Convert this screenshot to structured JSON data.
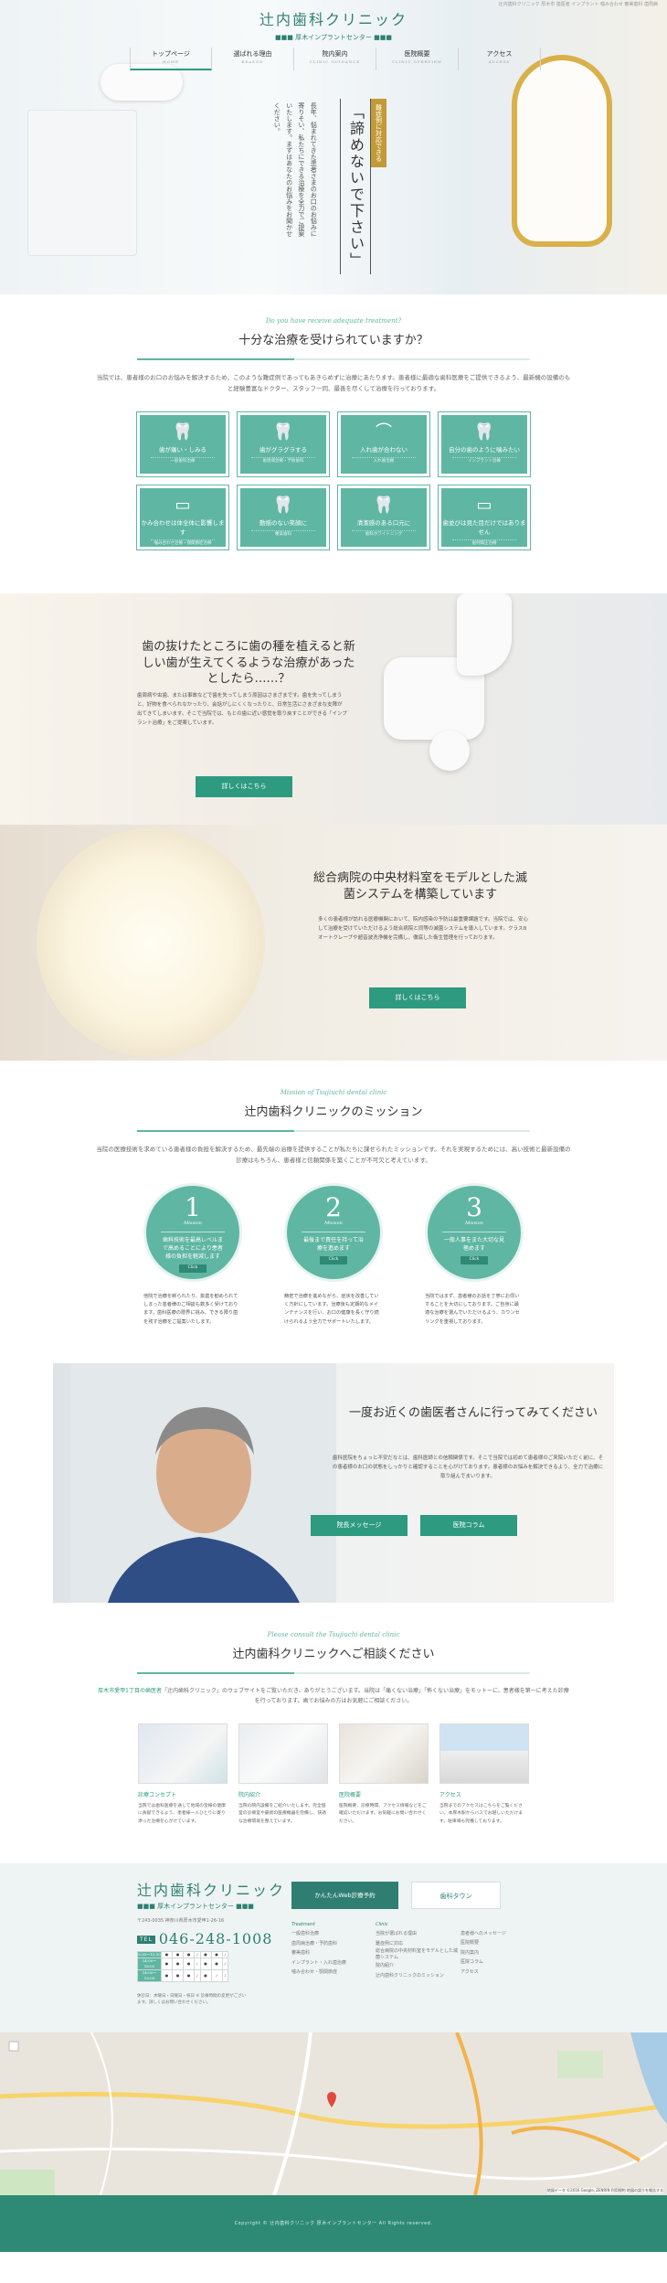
{
  "header": {
    "top_note": "辻内歯科クリニック 厚木市 歯医者 インプラント 噛み合わせ 審美歯科 歯周病",
    "clinic_name": "辻内歯科クリニック",
    "clinic_sub": "■■■ 厚木インプラントセンター ■■■",
    "nav": [
      {
        "jp": "トップページ",
        "en": "HOME"
      },
      {
        "jp": "選ばれる理由",
        "en": "REASON"
      },
      {
        "jp": "院内案内",
        "en": "CLINIC GUIDANCE"
      },
      {
        "jp": "医院概要",
        "en": "CLINIC OVERVIEW"
      },
      {
        "jp": "アクセス",
        "en": "ACCESS"
      }
    ]
  },
  "hero": {
    "badge": "難症例に対応できる",
    "main": "「諦めないで下さい」",
    "sub": "長年、悩まれてきた患者さまのお口のお悩みに寄りそい、私たちにできる治療を全力でご提案いたします。まずはあなたのお悩みをお聞かせください。"
  },
  "treatment": {
    "en": "Do you have receive adequate treatment?",
    "title": "十分な治療を受けられていますか？",
    "text": "当院では、患者様のお口のお悩みを解決するため、このような難症例であってもあきらめずに治療にあたります。患者様に最適な歯科医療をご提供できるよう、最新機の設備のもと経験豊富なドクター、スタッフ一同、最善を尽くして治療を行っております。",
    "tiles": [
      {
        "main": "歯が痛い・しみる",
        "sub": "一般歯科治療"
      },
      {
        "main": "歯がグラグラする",
        "sub": "歯周病治療・予防歯科"
      },
      {
        "main": "入れ歯が合わない",
        "sub": "入れ歯治療"
      },
      {
        "main": "自分の歯のように噛みたい",
        "sub": "インプラント治療"
      },
      {
        "main": "かみ合わせは体全体に影響します",
        "sub": "噛み合わせ治療・顎関節症治療"
      },
      {
        "main": "動揺のない笑顔に",
        "sub": "審美歯科"
      },
      {
        "main": "清潔感のある口元に",
        "sub": "歯科ホワイトニング"
      },
      {
        "main": "歯並びは見た目だけではありません",
        "sub": "歯列矯正治療"
      }
    ]
  },
  "implant": {
    "title": "歯の抜けたところに歯の種を植えると新しい歯が生えてくるような治療があったとしたら……？",
    "body": "歯周病や虫歯、または事故などで歯を失ってしまう原因はさまざまです。歯を失ってしまうと、好物を食べられなかったり、会話がしにくくなったりと、日常生活にさまざまな支障が出てきてしまいます。そこで当院では、もとの歯に近い感覚を取り戻すことができる「インプラント治療」をご提案しています。",
    "button": "詳しくはこちら"
  },
  "sterile": {
    "title": "総合病院の中央材料室をモデルとした滅菌システムを構築しています",
    "body": "多くの患者様が訪れる医療機関において、院内感染の予防は最重要課題です。当院では、安心して治療を受けていただけるよう総合病院と同等の滅菌システムを導入しています。クラスBオートクレーブや超音波洗浄機を完備し、徹底した衛生管理を行っております。",
    "button": "詳しくはこちら"
  },
  "mission": {
    "en": "Mission of Tsujiuchi dental clinic",
    "title": "辻内歯科クリニックのミッション",
    "text": "当院の医療技術を求めている患者様の負担を解決するため、最先端の治療を提供することが私たちに課せられたミッションです。それを実現するためには、高い技術と最新設備の診療はもちろん、患者様と信頼関係を築くことが不可欠と考えています。",
    "items": [
      {
        "num": "1",
        "en": "Mission",
        "text": "歯科技術を最高レベルまで高めることにより患者様の負担を軽減します",
        "click": "Click",
        "desc": "他院で治療を断られたり、抜歯を勧められてしまった患者様のご相談も数多く受けております。歯科医療の限界に挑み、できる限り歯を残す治療をご提案いたします。"
      },
      {
        "num": "2",
        "en": "Mission",
        "text": "最後まで責任を持って治療を進めます",
        "click": "Click",
        "desc": "精密で治療を進めながら、症状を改善していく方針にしています。治療後も定期的なメインテナンスを行い、お口の健康を長く守り続けられるよう全力でサポートいたします。"
      },
      {
        "num": "3",
        "en": "Mission",
        "text": "一般人事をまた大切な見極めます",
        "click": "Click",
        "desc": "当院ではまず、患者様のお話を丁寧にお伺いすることを大切にしております。ご自身に最適な治療を選んでいただけるよう、カウンセリングを重視しております。"
      }
    ]
  },
  "doctor": {
    "title": "一度お近くの歯医者さんに行ってみてください",
    "body": "歯科医院をちょっと不安だなとは、歯科医師との信頼関係です。そこで当院では初めて患者様のご来院いただく前に、その患者様のお口の状態をしっかりと確認することを心がけております。患者様のお悩みを解決できるよう、全力で治療に取り組んでまいります。",
    "btn1": "院長メッセージ",
    "btn2": "医院コラム"
  },
  "consult": {
    "en": "Please consult the Tsujiuchi dental clinic",
    "title": "辻内歯科クリニックへご相談ください",
    "intro_hl": "厚木市愛甲1丁目の歯医者",
    "intro": "「辻内歯科クリニック」のウェブサイトをご覧いただき、ありがとうございます。当院は「痛くない治療」「怖くない治療」をモットーに、患者様を第一に考えた診療を行っております。歯でお悩みの方はお気軽にご相談ください。",
    "cards": [
      {
        "title": "診療コンセプト",
        "desc": "当院では歯科医療を通じて地域の皆様の健康に貢献できるよう、患者様一人ひとりに寄り添った治療を心がけています。"
      },
      {
        "title": "院内紹介",
        "desc": "当院の院内設備をご紹介いたします。完全個室の診療室や最新の医療機器を完備し、快適な治療環境を整えています。"
      },
      {
        "title": "医院概要",
        "desc": "医院概要、診療時間、アクセス情報などをご確認いただけます。お気軽にお問い合わせください。"
      },
      {
        "title": "アクセス",
        "desc": "当院までのアクセスはこちらをご覧ください。本厚木駅からバスでお越しいただけます。駐車場も完備しております。"
      }
    ]
  },
  "footer": {
    "name": "辻内歯科クリニック",
    "sub": "■■■ 厚木インプラントセンター ■■■",
    "address": "〒243-0035 神奈川県厚木市愛甲1-26-16",
    "tel_label": "TEL",
    "tel": "046-248-1008",
    "hours_rows": [
      "9:30〜12:30",
      "14:00〜16:00",
      "14:00〜19:00"
    ],
    "notes": "休診日：木曜日・日曜日・祝日 ※ 診療時間の変更がございます。詳しくはお問い合わせください。",
    "web_button": "かんたんWeb診療予約",
    "banner": "歯科タウン",
    "col1_head": "Treatment",
    "col1": [
      "一般歯科治療",
      "歯周病治療・予防歯科",
      "審美歯科",
      "インプラント・入れ歯治療",
      "噛み合わせ・顎関節症"
    ],
    "col2_head": "Clinic",
    "col2": [
      "当院が選ばれる理由",
      "難症例に対応",
      "総合病院の中央材料室をモデルとした滅菌システム",
      "院内紹介",
      "辻内歯科クリニックのミッション"
    ],
    "col3": [
      "患者様へのメッセージ",
      "医院概要",
      "院内案内",
      "医院コラム",
      "アクセス"
    ]
  },
  "map": {
    "credit": "地図データ ©2016 Google, ZENRIN 利用規約 地図の誤りを報告する"
  },
  "copyright": "Copyright © 辻内歯科クリニック 厚木インプラントセンター All Rights reserved."
}
